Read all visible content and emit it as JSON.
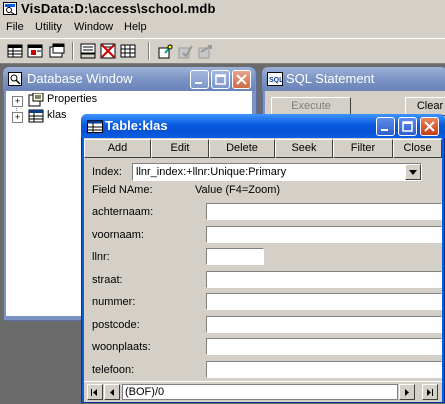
{
  "app": {
    "title": "VisData:D:\\access\\school.mdb"
  },
  "menu": [
    "File",
    "Utility",
    "Window",
    "Help"
  ],
  "toolbar": {
    "icons": [
      "dynaset-type-icon",
      "snapshot-type-icon",
      "table-type-icon",
      "use-data-control-icon",
      "use-no-data-control-icon",
      "use-dbgrid-icon",
      "begin-transaction-icon",
      "commit-icon",
      "rollback-icon"
    ]
  },
  "db_window": {
    "title": "Database Window",
    "items": [
      "Properties",
      "klas"
    ]
  },
  "sql_window": {
    "title": "SQL Statement",
    "execute_label": "Execute",
    "clear_label": "Clear"
  },
  "table_window": {
    "title": "Table:klas",
    "buttons": [
      "Add",
      "Edit",
      "Delete",
      "Seek",
      "Filter",
      "Close"
    ],
    "index_label": "Index:",
    "index_value": "llnr_index:+llnr:Unique:Primary",
    "field_header": "Field NAme:",
    "value_header": "Value (F4=Zoom)",
    "fields": [
      "achternaam:",
      "voornaam:",
      "llnr:",
      "straat:",
      "nummer:",
      "postcode:",
      "woonplaats:",
      "telefoon:"
    ],
    "nav_status": "(BOF)/0"
  },
  "colors": {
    "accent": "#0a5be0",
    "inactive_caption": "#7c94c4",
    "face": "#d4d0c8"
  }
}
